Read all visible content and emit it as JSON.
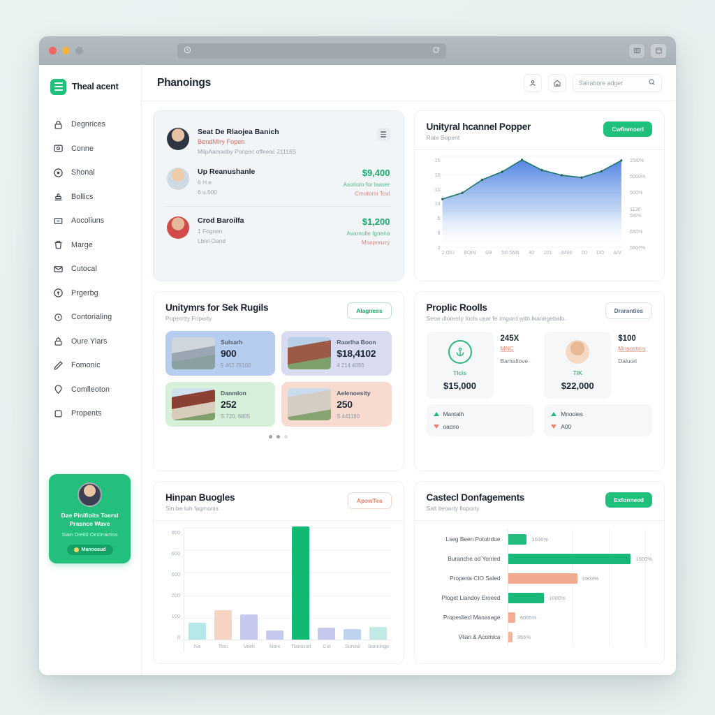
{
  "browser": {
    "url_value": "",
    "icons": {
      "shield": "shield-icon",
      "reload": "reload-icon",
      "split": "split-view-icon",
      "tabs": "tab-overview-icon"
    }
  },
  "sidebar": {
    "brand": "Theal acent",
    "items": [
      {
        "label": "Degnrices",
        "icon": "lock-icon"
      },
      {
        "label": "Conne",
        "icon": "camera-icon"
      },
      {
        "label": "Shonal",
        "icon": "clock-icon"
      },
      {
        "label": "Bollics",
        "icon": "stamp-icon"
      },
      {
        "label": "Aocoliuns",
        "icon": "minus-box-icon"
      },
      {
        "label": "Marge",
        "icon": "trash-icon"
      },
      {
        "label": "Cutocal",
        "icon": "mail-icon"
      },
      {
        "label": "Prgerbg",
        "icon": "target-icon"
      },
      {
        "label": "Contorialing",
        "icon": "clock-small-icon"
      },
      {
        "label": "Oure Yiars",
        "icon": "lock-alt-icon"
      },
      {
        "label": "Fomonic",
        "icon": "pen-icon"
      },
      {
        "label": "Comlleoton",
        "icon": "pin-icon"
      },
      {
        "label": "Propents",
        "icon": "square-icon"
      }
    ],
    "promo": {
      "title": "Dae Pinifioits Toersl Prasnce Wave",
      "subtitle": "Siain Dreti0 Oestrractios",
      "button": "Manoosud"
    }
  },
  "topbar": {
    "page_title": "Phanoings",
    "profile_icon": "user-icon",
    "home_icon": "home-icon",
    "search": {
      "placeholder": "Salrabore adger",
      "value": "",
      "icon": "search-icon"
    }
  },
  "listings_card": {
    "menu_icon": "more-menu-icon",
    "rows": [
      {
        "name": "Seat De Rlaojea Banich",
        "tag": "BendMlry Fopen",
        "meta": "MilpAamariby Ponpec offeeac 21118S",
        "price": "",
        "note": "",
        "note2": ""
      },
      {
        "name": "Up Reanushanle",
        "tag": "6 H.e",
        "meta": "6 u.500",
        "price": "$9,400",
        "note": "Asotiom for laaser",
        "note2": "Cmotorin Toxl"
      },
      {
        "name": "Crod Baroilfa",
        "tag": "1 Fognen",
        "meta": "Lbivi Oand",
        "price": "$1,200",
        "note": "Avarnolle Ignena",
        "note2": "Mseporucy"
      }
    ]
  },
  "chart_data": [
    {
      "id": "line-chart",
      "type": "line",
      "title": "Unityral hcannel Popper",
      "subtitle": "Rate Bopent",
      "action_label": "Cwfinmoerl",
      "x": [
        "2 OIU",
        "BOIN",
        "G9",
        "5I0 5NN",
        "40",
        "201",
        "8400",
        "00",
        "DO",
        "A/V"
      ],
      "values": [
        8.1,
        9.2,
        11.5,
        12.9,
        15.0,
        13.2,
        12.3,
        11.9,
        13.0,
        14.9
      ],
      "ylim": [
        0,
        15
      ],
      "ytick_labels": [
        "15",
        "10",
        "10",
        "14",
        "5",
        "8",
        "0"
      ],
      "y2tick_labels": [
        "15I0%",
        "5000%",
        "500%",
        "1130 5I6%",
        "680%",
        "5807%"
      ],
      "grid": true,
      "legend": "none",
      "series_color": "#2e8f7c",
      "fill_top": "#5b86e5",
      "fill_bottom": "#ffffff"
    },
    {
      "id": "bar-chart",
      "type": "bar",
      "title": "Hinpan Buogles",
      "subtitle": "Sin be Iuh fagmonis",
      "action_label": "ApowTea",
      "categories": [
        "Na",
        "Torc",
        "Veeh",
        "Norx",
        "Tlanocial",
        "Cut",
        "Sorvail",
        "Sanninge"
      ],
      "values": [
        118,
        208,
        182,
        64,
        812,
        84,
        76,
        88
      ],
      "colors": [
        "#b6e8ea",
        "#f8d3c4",
        "#c6c9ee",
        "#c6c9ee",
        "#11b973",
        "#c6c9ee",
        "#bed3f0",
        "#bfeae6"
      ],
      "ylim": [
        0,
        800
      ],
      "ytick_labels": [
        "800",
        "600",
        "600",
        "200",
        "100",
        "0"
      ],
      "grid": true
    },
    {
      "id": "hbar-chart",
      "type": "bar",
      "orientation": "horizontal",
      "title": "Castecl Donfagements",
      "subtitle": "Salt Ileoarty Iloporty",
      "action_label": "Exfonneed",
      "categories": [
        "Lseg Been Pototrdue",
        "Buranche od Yorried",
        "Properta CIO Saled",
        "Ploget Liandoy Eroeed",
        "Propesliecl Manasage",
        "Vlian & Acomica"
      ],
      "values": [
        13,
        95,
        48,
        25,
        5,
        3
      ],
      "value_labels": [
        "1036%",
        "1500%",
        "1903%",
        "1000%",
        "6085%",
        "955%"
      ],
      "colors": [
        "#22bd7d",
        "#18b978",
        "#f3a98e",
        "#18b978",
        "#f4ad93",
        "#f4b59c"
      ],
      "xlim": [
        0,
        100
      ],
      "grid": true
    }
  ],
  "property_card": {
    "title": "Unitymrs for Sek Rugils",
    "subtitle": "Poperrtty Foperty",
    "action_label": "Alagness",
    "tiles": [
      {
        "label": "Sulsarh",
        "value": "900",
        "meta": "5 463 75100",
        "bg": "#b6cdf0",
        "img": "house-suburb-image"
      },
      {
        "label": "Raorlha Boon",
        "value": "$18,4102",
        "meta": "4 214 4093",
        "bg": "#d9dcf0",
        "img": "house-brick-image"
      },
      {
        "label": "Danmlon",
        "value": "252",
        "meta": "S 720, 6805",
        "bg": "#d5efd9",
        "img": "house-ranch-image"
      },
      {
        "label": "Aelenoesity",
        "value": "250",
        "meta": "S 441180",
        "bg": "#f8dbd0",
        "img": "house-colonial-image"
      }
    ],
    "pagination": [
      true,
      true,
      false
    ]
  },
  "rolls_card": {
    "title": "Proplic Roolls",
    "subtitle": "Seoe dlorerrly Iocls usar fe imgord with Ikanegebalo.",
    "action_label": "Draranties",
    "columns": [
      {
        "badge_icon": "anchor-icon",
        "badge_label": "Tlcis",
        "badge_value": "$15,000",
        "info_value": "245X",
        "info_tag": "MNC",
        "info_sub": "Bamaltove",
        "foot_up": "Mantalh",
        "foot_dn": "oacno"
      },
      {
        "badge_icon": "avatar-icon",
        "badge_label": "TIK",
        "badge_value": "$22,000",
        "info_value": "$100",
        "info_tag": "Mnaostms",
        "info_sub": "Daluort",
        "foot_up": "Mnooies",
        "foot_dn": "A00"
      }
    ]
  }
}
